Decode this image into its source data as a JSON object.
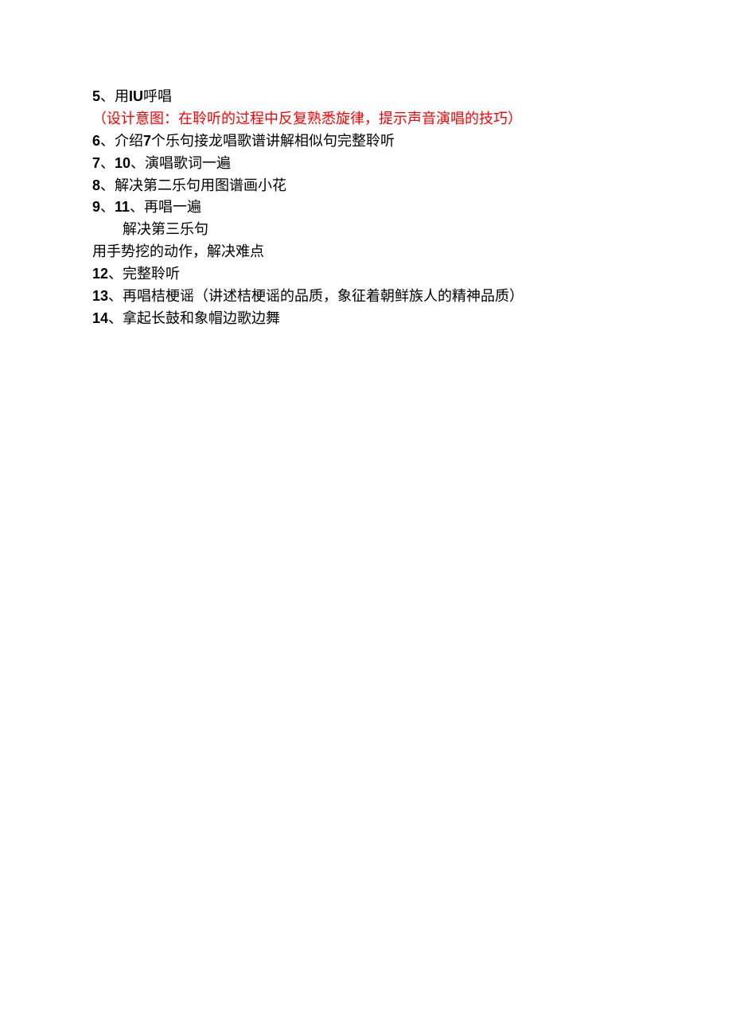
{
  "lines": {
    "l1_num": "5",
    "l1_sep": "、",
    "l1_bold": "IU",
    "l1_pre": "用",
    "l1_post": "呼唱",
    "l2": "（设计意图：在聆听的过程中反复熟悉旋律，提示声音演唱的技巧）",
    "l3_num": "6",
    "l3_sep": "、",
    "l3_pre": "介绍",
    "l3_bold": "7",
    "l3_post": "个乐句接龙唱歌谱讲解相似句完整聆听",
    "l4_num1": "7",
    "l4_sep1": "、",
    "l4_num2": "10",
    "l4_sep2": "、",
    "l4_text": "演唱歌词一遍",
    "l5_num": "8",
    "l5_sep": "、",
    "l5_text": "解决第二乐句用图谱画小花",
    "l6_num1": "9",
    "l6_sep1": "、",
    "l6_num2": "11",
    "l6_sep2": "、",
    "l6_text": "再唱一遍",
    "l7_text": "解决第三乐句",
    "l8_text": "用手势挖的动作，解决难点",
    "l9_num": "12",
    "l9_sep": "、",
    "l9_text": "完整聆听",
    "l10_num": "13",
    "l10_sep": "、",
    "l10_text": "再唱桔梗谣（讲述桔梗谣的品质，象征着朝鲜族人的精神品质）",
    "l11_num": "14",
    "l11_sep": "、",
    "l11_text": "拿起长鼓和象帽边歌边舞"
  }
}
